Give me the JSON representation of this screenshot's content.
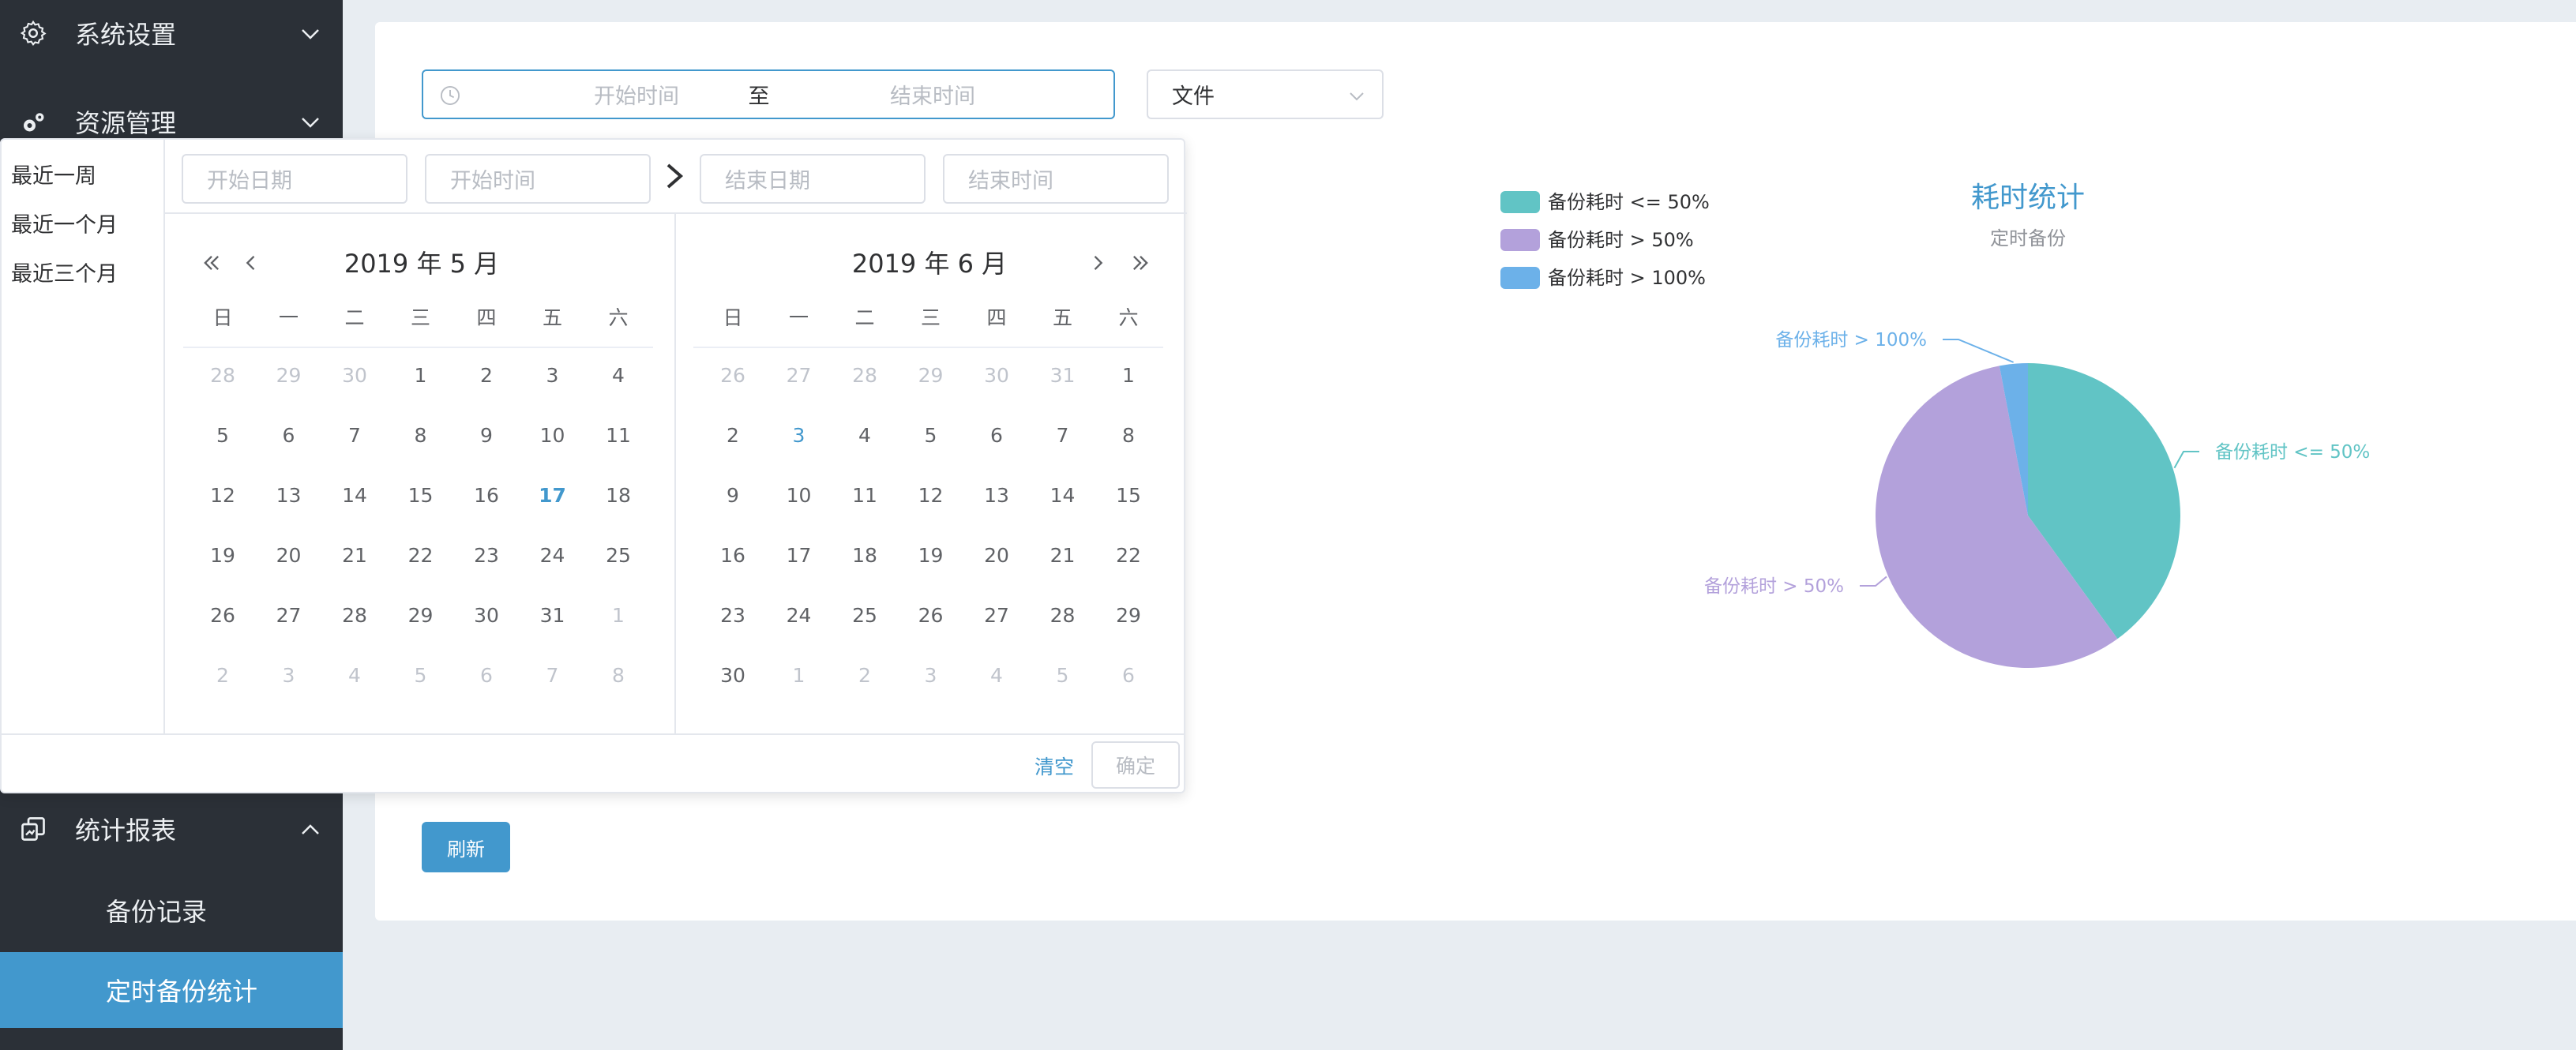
{
  "sidebar": {
    "menu": [
      {
        "label": "系统设置",
        "icon": "gear-icon"
      },
      {
        "label": "资源管理",
        "icon": "gears-icon"
      },
      {
        "label": "统计报表",
        "icon": "report-icon"
      }
    ],
    "submenu": [
      {
        "label": "备份记录",
        "active": false
      },
      {
        "label": "定时备份统计",
        "active": true
      }
    ]
  },
  "filters": {
    "start_placeholder": "开始时间",
    "range_separator": "至",
    "end_placeholder": "结束时间",
    "type_value": "文件",
    "refresh_label": "刷新"
  },
  "picker": {
    "shortcuts": [
      "最近一周",
      "最近一个月",
      "最近三个月"
    ],
    "start_date_placeholder": "开始日期",
    "start_time_placeholder": "开始时间",
    "end_date_placeholder": "结束日期",
    "end_time_placeholder": "结束时间",
    "weekdays": [
      "日",
      "一",
      "二",
      "三",
      "四",
      "五",
      "六"
    ],
    "left_title": "2019 年 5 月",
    "right_title": "2019 年 6 月",
    "left_days": [
      [
        "28",
        "29",
        "30",
        "1",
        "2",
        "3",
        "4"
      ],
      [
        "5",
        "6",
        "7",
        "8",
        "9",
        "10",
        "11"
      ],
      [
        "12",
        "13",
        "14",
        "15",
        "16",
        "17",
        "18"
      ],
      [
        "19",
        "20",
        "21",
        "22",
        "23",
        "24",
        "25"
      ],
      [
        "26",
        "27",
        "28",
        "29",
        "30",
        "31",
        "1"
      ],
      [
        "2",
        "3",
        "4",
        "5",
        "6",
        "7",
        "8"
      ]
    ],
    "right_days": [
      [
        "26",
        "27",
        "28",
        "29",
        "30",
        "31",
        "1"
      ],
      [
        "2",
        "3",
        "4",
        "5",
        "6",
        "7",
        "8"
      ],
      [
        "9",
        "10",
        "11",
        "12",
        "13",
        "14",
        "15"
      ],
      [
        "16",
        "17",
        "18",
        "19",
        "20",
        "21",
        "22"
      ],
      [
        "23",
        "24",
        "25",
        "26",
        "27",
        "28",
        "29"
      ],
      [
        "30",
        "1",
        "2",
        "3",
        "4",
        "5",
        "6"
      ]
    ],
    "left_today": "17",
    "right_highlight": "3",
    "clear_label": "清空",
    "confirm_label": "确定"
  },
  "chart_data": {
    "type": "pie",
    "title": "耗时统计",
    "subtitle": "定时备份",
    "legend_position": "top-left",
    "series": [
      {
        "name": "备份耗时 <= 50%",
        "value": 40,
        "color": "#61c4c5"
      },
      {
        "name": "备份耗时 > 50%",
        "value": 57,
        "color": "#b3a1db"
      },
      {
        "name": "备份耗时 > 100%",
        "value": 3,
        "color": "#6cb1e9"
      }
    ]
  }
}
